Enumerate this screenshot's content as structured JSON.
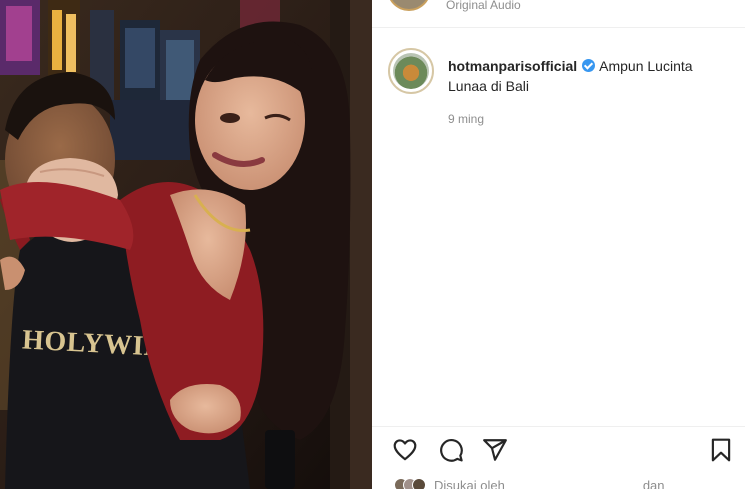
{
  "header": {
    "subtitle": "Original Audio"
  },
  "post": {
    "username": "hotmanparisofficial",
    "caption": "Ampun Lucinta Lunaa di Bali",
    "time": "9 ming"
  },
  "media": {
    "shirt_text": "HOLYWINGS"
  },
  "likes": {
    "prefix": "Disukai oleh",
    "conj": "dan"
  },
  "icons": [
    "heart-icon",
    "comment-icon",
    "share-icon",
    "bookmark-icon",
    "verified-badge-icon"
  ],
  "colors": {
    "verified": "#3897f0",
    "dress": "#8e1c22",
    "shirt": "#16161a"
  }
}
